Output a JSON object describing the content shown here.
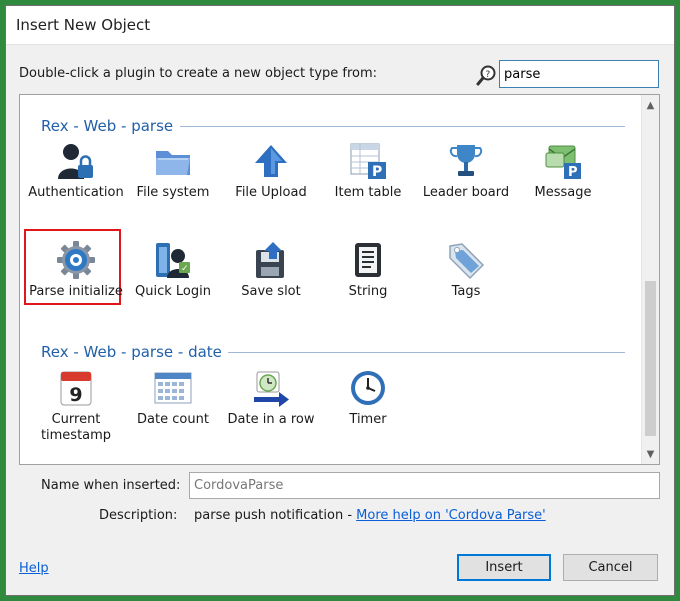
{
  "window": {
    "title": "Insert New Object"
  },
  "header": {
    "instruction": "Double-click a plugin to create a new object type from:",
    "search": {
      "value": "parse"
    }
  },
  "groups": [
    {
      "label": "Rex - Web - parse",
      "items": [
        {
          "label": "Authentication",
          "icon": "user-lock-icon"
        },
        {
          "label": "File system",
          "icon": "folder-icon"
        },
        {
          "label": "File Upload",
          "icon": "upload-arrow-icon"
        },
        {
          "label": "Item table",
          "icon": "table-p-icon"
        },
        {
          "label": "Leader board",
          "icon": "trophy-icon"
        },
        {
          "label": "Message",
          "icon": "message-icon"
        },
        {
          "label": "Parse initialize",
          "icon": "gear-icon",
          "selected": true
        },
        {
          "label": "Quick Login",
          "icon": "quick-login-icon"
        },
        {
          "label": "Save slot",
          "icon": "save-slot-icon"
        },
        {
          "label": "String",
          "icon": "string-icon"
        },
        {
          "label": "Tags",
          "icon": "tag-icon"
        }
      ]
    },
    {
      "label": "Rex - Web - parse - date",
      "items": [
        {
          "label": "Current timestamp",
          "icon": "calendar-icon",
          "day": "9"
        },
        {
          "label": "Date count",
          "icon": "calendar-grid-icon"
        },
        {
          "label": "Date in a row",
          "icon": "clock-arrow-icon"
        },
        {
          "label": "Timer",
          "icon": "clock-icon"
        }
      ]
    }
  ],
  "footer": {
    "name_label": "Name when inserted:",
    "name_value": "CordovaParse",
    "description_label": "Description:",
    "description_text": "parse push notification - ",
    "description_link": "More help on 'Cordova Parse'",
    "help_label": "Help",
    "insert_label": "Insert",
    "cancel_label": "Cancel"
  },
  "colors": {
    "group_header": "#2160a8",
    "selection_border": "#e0161c",
    "link": "#0a5ed6",
    "background": "#2f8a3e"
  }
}
